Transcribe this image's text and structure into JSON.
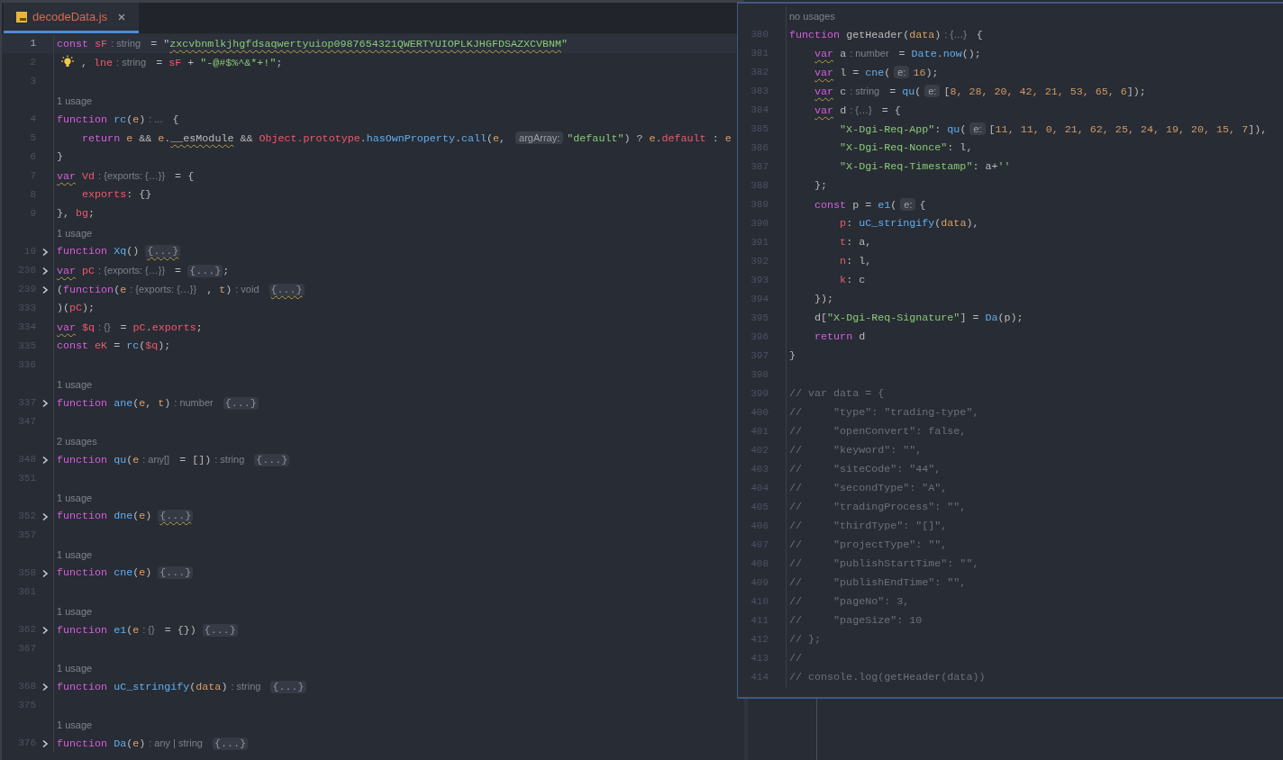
{
  "tab": {
    "label": "decodeData.js",
    "selected": true
  },
  "editor": {
    "lines": [
      {
        "kind": "code",
        "number": "1",
        "current": true,
        "tokens": [
          {
            "kind": "kw",
            "text": "const"
          },
          {
            "kind": "var",
            "text": " sF"
          },
          {
            "kind": "type-hint",
            "text": ": string"
          },
          {
            "kind": "pl",
            "text": " = \""
          },
          {
            "kind": "str",
            "text": "zxcvbnmlkjhgfdsaqwertyuiop0987654321QWERTYUIOPLKJHGFDSAZXCVBNM",
            "wavy": true
          },
          {
            "kind": "str",
            "text": "\""
          }
        ]
      },
      {
        "kind": "code",
        "number": "2",
        "bulb": true,
        "tokens": [
          {
            "kind": "pl",
            "text": " , "
          },
          {
            "kind": "var",
            "text": "lne"
          },
          {
            "kind": "type-hint",
            "text": ": string"
          },
          {
            "kind": "pl",
            "text": " = "
          },
          {
            "kind": "var",
            "text": "sF"
          },
          {
            "kind": "pl",
            "text": " + "
          },
          {
            "kind": "str",
            "text": "\"-@#$%^&*+!\""
          },
          {
            "kind": "pl",
            "text": ";"
          }
        ]
      },
      {
        "kind": "code",
        "number": "3"
      },
      {
        "kind": "usage",
        "text": "1 usage"
      },
      {
        "kind": "code",
        "number": "4",
        "tokens": [
          {
            "kind": "kw",
            "text": "function"
          },
          {
            "kind": "fn",
            "text": " rc"
          },
          {
            "kind": "pl",
            "text": "("
          },
          {
            "kind": "param",
            "text": "e"
          },
          {
            "kind": "pl",
            "text": ")"
          },
          {
            "kind": "type-hint",
            "text": ": ..."
          },
          {
            "kind": "pl",
            "text": " {"
          }
        ]
      },
      {
        "kind": "code",
        "number": "5",
        "tokens": [
          {
            "kind": "kw",
            "text": "    return"
          },
          {
            "kind": "param",
            "text": " e"
          },
          {
            "kind": "pl",
            "text": " && "
          },
          {
            "kind": "param",
            "text": "e"
          },
          {
            "kind": "pl",
            "text": "."
          },
          {
            "kind": "pl",
            "text": "__esModule",
            "wavy": true
          },
          {
            "kind": "pl",
            "text": " && "
          },
          {
            "kind": "var",
            "text": "Object.prototype"
          },
          {
            "kind": "pl",
            "text": "."
          },
          {
            "kind": "fn",
            "text": "hasOwnProperty"
          },
          {
            "kind": "pl",
            "text": "."
          },
          {
            "kind": "fn",
            "text": "call"
          },
          {
            "kind": "pl",
            "text": "("
          },
          {
            "kind": "param",
            "text": "e"
          },
          {
            "kind": "pl",
            "text": ", "
          },
          {
            "kind": "param-hint",
            "text": "argArray:"
          },
          {
            "kind": "str",
            "text": "\"default\""
          },
          {
            "kind": "pl",
            "text": ") ? "
          },
          {
            "kind": "param",
            "text": "e"
          },
          {
            "kind": "pl",
            "text": "."
          },
          {
            "kind": "var",
            "text": "default"
          },
          {
            "kind": "pl",
            "text": " : "
          },
          {
            "kind": "param",
            "text": "e"
          }
        ]
      },
      {
        "kind": "code",
        "number": "6",
        "tokens": [
          {
            "kind": "pl",
            "text": "}"
          }
        ]
      },
      {
        "kind": "code",
        "number": "7",
        "tokens": [
          {
            "kind": "kw",
            "text": "var",
            "wavy": true
          },
          {
            "kind": "var",
            "text": " Vd"
          },
          {
            "kind": "type-hint",
            "text": ": {exports: {…}}"
          },
          {
            "kind": "pl",
            "text": " = {"
          }
        ]
      },
      {
        "kind": "code",
        "number": "8",
        "tokens": [
          {
            "kind": "var",
            "text": "    exports"
          },
          {
            "kind": "pl",
            "text": ": {}"
          }
        ]
      },
      {
        "kind": "code",
        "number": "9",
        "tokens": [
          {
            "kind": "pl",
            "text": "}, "
          },
          {
            "kind": "var",
            "text": "bg"
          },
          {
            "kind": "pl",
            "text": ";"
          }
        ]
      },
      {
        "kind": "usage",
        "text": "1 usage"
      },
      {
        "kind": "code",
        "number": "10",
        "folded": true,
        "tokens": [
          {
            "kind": "kw",
            "text": "function"
          },
          {
            "kind": "fn",
            "text": " Xq"
          },
          {
            "kind": "pl",
            "text": "() "
          },
          {
            "kind": "fold",
            "text": "{...}",
            "wavy": true
          }
        ]
      },
      {
        "kind": "code",
        "number": "236",
        "folded": true,
        "tokens": [
          {
            "kind": "kw",
            "text": "var",
            "wavy": true
          },
          {
            "kind": "var",
            "text": " pC"
          },
          {
            "kind": "type-hint",
            "text": ": {exports: {…}}"
          },
          {
            "kind": "pl",
            "text": " = "
          },
          {
            "kind": "fold",
            "text": "{...}"
          },
          {
            "kind": "pl",
            "text": ";"
          }
        ]
      },
      {
        "kind": "code",
        "number": "239",
        "folded": true,
        "tokens": [
          {
            "kind": "pl",
            "text": "("
          },
          {
            "kind": "kw",
            "text": "function"
          },
          {
            "kind": "pl",
            "text": "("
          },
          {
            "kind": "param",
            "text": "e"
          },
          {
            "kind": "type-hint",
            "text": ": {exports: {…}}"
          },
          {
            "kind": "pl",
            "text": " , "
          },
          {
            "kind": "param",
            "text": "t"
          },
          {
            "kind": "pl",
            "text": ")"
          },
          {
            "kind": "type-hint",
            "text": ": void"
          },
          {
            "kind": "fold",
            "text": " {...}",
            "wavy": true
          }
        ]
      },
      {
        "kind": "code",
        "number": "333",
        "tokens": [
          {
            "kind": "pl",
            "text": ")("
          },
          {
            "kind": "var",
            "text": "pC"
          },
          {
            "kind": "pl",
            "text": ");"
          }
        ]
      },
      {
        "kind": "code",
        "number": "334",
        "tokens": [
          {
            "kind": "kw",
            "text": "var",
            "wavy": true
          },
          {
            "kind": "var",
            "text": " $q"
          },
          {
            "kind": "type-hint",
            "text": ": {}"
          },
          {
            "kind": "pl",
            "text": " = "
          },
          {
            "kind": "var",
            "text": "pC"
          },
          {
            "kind": "pl",
            "text": "."
          },
          {
            "kind": "var",
            "text": "exports"
          },
          {
            "kind": "pl",
            "text": ";"
          }
        ]
      },
      {
        "kind": "code",
        "number": "335",
        "tokens": [
          {
            "kind": "kw",
            "text": "const"
          },
          {
            "kind": "var",
            "text": " eK"
          },
          {
            "kind": "pl",
            "text": " = "
          },
          {
            "kind": "fn",
            "text": "rc"
          },
          {
            "kind": "pl",
            "text": "("
          },
          {
            "kind": "var",
            "text": "$q"
          },
          {
            "kind": "pl",
            "text": ");"
          }
        ]
      },
      {
        "kind": "code",
        "number": "336"
      },
      {
        "kind": "usage",
        "text": "1 usage"
      },
      {
        "kind": "code",
        "number": "337",
        "folded": true,
        "tokens": [
          {
            "kind": "kw",
            "text": "function"
          },
          {
            "kind": "fn",
            "text": " ane"
          },
          {
            "kind": "pl",
            "text": "("
          },
          {
            "kind": "param",
            "text": "e"
          },
          {
            "kind": "pl",
            "text": ", "
          },
          {
            "kind": "param",
            "text": "t"
          },
          {
            "kind": "pl",
            "text": ")"
          },
          {
            "kind": "type-hint",
            "text": ": number"
          },
          {
            "kind": "fold",
            "text": " {...}"
          }
        ]
      },
      {
        "kind": "code",
        "number": "347"
      },
      {
        "kind": "usage",
        "text": "2 usages"
      },
      {
        "kind": "code",
        "number": "348",
        "folded": true,
        "tokens": [
          {
            "kind": "kw",
            "text": "function"
          },
          {
            "kind": "fn",
            "text": " qu"
          },
          {
            "kind": "pl",
            "text": "("
          },
          {
            "kind": "param",
            "text": "e"
          },
          {
            "kind": "type-hint",
            "text": ": any[]"
          },
          {
            "kind": "pl",
            "text": " = [])"
          },
          {
            "kind": "type-hint",
            "text": ": string"
          },
          {
            "kind": "fold",
            "text": " {...}"
          }
        ]
      },
      {
        "kind": "code",
        "number": "351"
      },
      {
        "kind": "usage",
        "text": "1 usage"
      },
      {
        "kind": "code",
        "number": "352",
        "folded": true,
        "tokens": [
          {
            "kind": "kw",
            "text": "function"
          },
          {
            "kind": "fn",
            "text": " dne"
          },
          {
            "kind": "pl",
            "text": "("
          },
          {
            "kind": "param",
            "text": "e"
          },
          {
            "kind": "pl",
            "text": ") "
          },
          {
            "kind": "fold",
            "text": "{...}",
            "wavy": true
          }
        ]
      },
      {
        "kind": "code",
        "number": "357"
      },
      {
        "kind": "usage",
        "text": "1 usage"
      },
      {
        "kind": "code",
        "number": "358",
        "folded": true,
        "tokens": [
          {
            "kind": "kw",
            "text": "function"
          },
          {
            "kind": "fn",
            "text": " cne"
          },
          {
            "kind": "pl",
            "text": "("
          },
          {
            "kind": "param",
            "text": "e"
          },
          {
            "kind": "pl",
            "text": ") "
          },
          {
            "kind": "fold",
            "text": "{...}"
          }
        ]
      },
      {
        "kind": "code",
        "number": "361"
      },
      {
        "kind": "usage",
        "text": "1 usage"
      },
      {
        "kind": "code",
        "number": "362",
        "folded": true,
        "tokens": [
          {
            "kind": "kw",
            "text": "function"
          },
          {
            "kind": "fn",
            "text": " e1"
          },
          {
            "kind": "pl",
            "text": "("
          },
          {
            "kind": "param",
            "text": "e"
          },
          {
            "kind": "type-hint",
            "text": ": {}"
          },
          {
            "kind": "pl",
            "text": " = {}) "
          },
          {
            "kind": "fold",
            "text": "{...}"
          }
        ]
      },
      {
        "kind": "code",
        "number": "367"
      },
      {
        "kind": "usage",
        "text": "1 usage"
      },
      {
        "kind": "code",
        "number": "368",
        "folded": true,
        "tokens": [
          {
            "kind": "kw",
            "text": "function"
          },
          {
            "kind": "fn",
            "text": " uC_stringify"
          },
          {
            "kind": "pl",
            "text": "("
          },
          {
            "kind": "param",
            "text": "data"
          },
          {
            "kind": "pl",
            "text": ")"
          },
          {
            "kind": "type-hint",
            "text": ": string"
          },
          {
            "kind": "fold",
            "text": " {...}"
          }
        ]
      },
      {
        "kind": "code",
        "number": "375"
      },
      {
        "kind": "usage",
        "text": "1 usage"
      },
      {
        "kind": "code",
        "number": "376",
        "folded": true,
        "tokens": [
          {
            "kind": "kw",
            "text": "function"
          },
          {
            "kind": "fn",
            "text": " Da"
          },
          {
            "kind": "pl",
            "text": "("
          },
          {
            "kind": "param",
            "text": "e"
          },
          {
            "kind": "pl",
            "text": ")"
          },
          {
            "kind": "type-hint",
            "text": ": any | string"
          },
          {
            "kind": "fold",
            "text": " {...}"
          }
        ]
      }
    ]
  },
  "popup": {
    "lines": [
      {
        "kind": "usage",
        "text": "no usages"
      },
      {
        "kind": "code",
        "number": "380",
        "tokens": [
          {
            "kind": "kw",
            "text": "function"
          },
          {
            "kind": "pl",
            "text": " getHeader("
          },
          {
            "kind": "param",
            "text": "data"
          },
          {
            "kind": "pl",
            "text": ")"
          },
          {
            "kind": "type-hint",
            "text": ": {…}"
          },
          {
            "kind": "pl",
            "text": " {"
          }
        ]
      },
      {
        "kind": "code",
        "number": "381",
        "tokens": [
          {
            "kind": "kw",
            "text": "    var",
            "wavy": true
          },
          {
            "kind": "pl",
            "text": " a"
          },
          {
            "kind": "type-hint",
            "text": ": number"
          },
          {
            "kind": "pl",
            "text": " = "
          },
          {
            "kind": "fn",
            "text": "Date"
          },
          {
            "kind": "pl",
            "text": "."
          },
          {
            "kind": "fn",
            "text": "now"
          },
          {
            "kind": "pl",
            "text": "();"
          }
        ]
      },
      {
        "kind": "code",
        "number": "382",
        "tokens": [
          {
            "kind": "kw",
            "text": "    var",
            "wavy": true
          },
          {
            "kind": "pl",
            "text": " l = "
          },
          {
            "kind": "fn",
            "text": "cne"
          },
          {
            "kind": "pl",
            "text": "("
          },
          {
            "kind": "param-hint",
            "text": "e:"
          },
          {
            "kind": "num",
            "text": "16"
          },
          {
            "kind": "pl",
            "text": ");"
          }
        ]
      },
      {
        "kind": "code",
        "number": "383",
        "tokens": [
          {
            "kind": "kw",
            "text": "    var",
            "wavy": true
          },
          {
            "kind": "pl",
            "text": " c"
          },
          {
            "kind": "type-hint",
            "text": ": string"
          },
          {
            "kind": "pl",
            "text": " = "
          },
          {
            "kind": "fn",
            "text": "qu"
          },
          {
            "kind": "pl",
            "text": "("
          },
          {
            "kind": "param-hint",
            "text": "e:"
          },
          {
            "kind": "pl",
            "text": "["
          },
          {
            "kind": "num",
            "text": "8, 28, 20, 42, 21, 53, 65, 6"
          },
          {
            "kind": "pl",
            "text": "]);"
          }
        ]
      },
      {
        "kind": "code",
        "number": "384",
        "tokens": [
          {
            "kind": "kw",
            "text": "    var",
            "wavy": true
          },
          {
            "kind": "pl",
            "text": " d"
          },
          {
            "kind": "type-hint",
            "text": ": {…}"
          },
          {
            "kind": "pl",
            "text": " = {"
          }
        ]
      },
      {
        "kind": "code",
        "number": "385",
        "tokens": [
          {
            "kind": "str",
            "text": "        \"X-Dgi-Req-App\""
          },
          {
            "kind": "pl",
            "text": ": "
          },
          {
            "kind": "fn",
            "text": "qu"
          },
          {
            "kind": "pl",
            "text": "("
          },
          {
            "kind": "param-hint",
            "text": "e:"
          },
          {
            "kind": "pl",
            "text": "["
          },
          {
            "kind": "num",
            "text": "11, 11, 0, 21, 62, 25, 24, 19, 20, 15, 7"
          },
          {
            "kind": "pl",
            "text": "]),"
          }
        ]
      },
      {
        "kind": "code",
        "number": "386",
        "tokens": [
          {
            "kind": "str",
            "text": "        \"X-Dgi-Req-Nonce\""
          },
          {
            "kind": "pl",
            "text": ": l,"
          }
        ]
      },
      {
        "kind": "code",
        "number": "387",
        "tokens": [
          {
            "kind": "str",
            "text": "        \"X-Dgi-Req-Timestamp\""
          },
          {
            "kind": "pl",
            "text": ": a+"
          },
          {
            "kind": "str",
            "text": "''"
          }
        ]
      },
      {
        "kind": "code",
        "number": "388",
        "tokens": [
          {
            "kind": "pl",
            "text": "    };"
          }
        ]
      },
      {
        "kind": "code",
        "number": "389",
        "tokens": [
          {
            "kind": "kw",
            "text": "    const"
          },
          {
            "kind": "pl",
            "text": " p = "
          },
          {
            "kind": "fn",
            "text": "e1"
          },
          {
            "kind": "pl",
            "text": "("
          },
          {
            "kind": "param-hint",
            "text": "e:"
          },
          {
            "kind": "pl",
            "text": "{"
          }
        ]
      },
      {
        "kind": "code",
        "number": "390",
        "tokens": [
          {
            "kind": "var",
            "text": "        p"
          },
          {
            "kind": "pl",
            "text": ": "
          },
          {
            "kind": "fn",
            "text": "uC_stringify"
          },
          {
            "kind": "pl",
            "text": "("
          },
          {
            "kind": "param",
            "text": "data"
          },
          {
            "kind": "pl",
            "text": "),"
          }
        ]
      },
      {
        "kind": "code",
        "number": "391",
        "tokens": [
          {
            "kind": "var",
            "text": "        t"
          },
          {
            "kind": "pl",
            "text": ": a,"
          }
        ]
      },
      {
        "kind": "code",
        "number": "392",
        "tokens": [
          {
            "kind": "var",
            "text": "        n"
          },
          {
            "kind": "pl",
            "text": ": l,"
          }
        ]
      },
      {
        "kind": "code",
        "number": "393",
        "tokens": [
          {
            "kind": "var",
            "text": "        k"
          },
          {
            "kind": "pl",
            "text": ": c"
          }
        ]
      },
      {
        "kind": "code",
        "number": "394",
        "tokens": [
          {
            "kind": "pl",
            "text": "    });"
          }
        ]
      },
      {
        "kind": "code",
        "number": "395",
        "tokens": [
          {
            "kind": "pl",
            "text": "    d["
          },
          {
            "kind": "str",
            "text": "\"X-Dgi-Req-Signature\""
          },
          {
            "kind": "pl",
            "text": "] = "
          },
          {
            "kind": "fn",
            "text": "Da"
          },
          {
            "kind": "pl",
            "text": "(p);"
          }
        ]
      },
      {
        "kind": "code",
        "number": "396",
        "tokens": [
          {
            "kind": "kw",
            "text": "    return"
          },
          {
            "kind": "pl",
            "text": " d"
          }
        ]
      },
      {
        "kind": "code",
        "number": "397",
        "tokens": [
          {
            "kind": "pl",
            "text": "}"
          }
        ]
      },
      {
        "kind": "code",
        "number": "398"
      },
      {
        "kind": "code",
        "number": "399",
        "tokens": [
          {
            "kind": "cmt",
            "text": "// var data = {"
          }
        ]
      },
      {
        "kind": "code",
        "number": "400",
        "tokens": [
          {
            "kind": "cmt",
            "text": "//     \"type\": \"trading-type\","
          }
        ]
      },
      {
        "kind": "code",
        "number": "401",
        "tokens": [
          {
            "kind": "cmt",
            "text": "//     \"openConvert\": false,"
          }
        ]
      },
      {
        "kind": "code",
        "number": "402",
        "tokens": [
          {
            "kind": "cmt",
            "text": "//     \"keyword\": \"\","
          }
        ]
      },
      {
        "kind": "code",
        "number": "403",
        "tokens": [
          {
            "kind": "cmt",
            "text": "//     \"siteCode\": \"44\","
          }
        ]
      },
      {
        "kind": "code",
        "number": "404",
        "tokens": [
          {
            "kind": "cmt",
            "text": "//     \"secondType\": \"A\","
          }
        ]
      },
      {
        "kind": "code",
        "number": "405",
        "tokens": [
          {
            "kind": "cmt",
            "text": "//     \"tradingProcess\": \"\","
          }
        ]
      },
      {
        "kind": "code",
        "number": "406",
        "tokens": [
          {
            "kind": "cmt",
            "text": "//     \"thirdType\": \"[]\","
          }
        ]
      },
      {
        "kind": "code",
        "number": "407",
        "tokens": [
          {
            "kind": "cmt",
            "text": "//     \"projectType\": \"\","
          }
        ]
      },
      {
        "kind": "code",
        "number": "408",
        "tokens": [
          {
            "kind": "cmt",
            "text": "//     \"publishStartTime\": \"\","
          }
        ]
      },
      {
        "kind": "code",
        "number": "409",
        "tokens": [
          {
            "kind": "cmt",
            "text": "//     \"publishEndTime\": \"\","
          }
        ]
      },
      {
        "kind": "code",
        "number": "410",
        "tokens": [
          {
            "kind": "cmt",
            "text": "//     \"pageNo\": 3,"
          }
        ]
      },
      {
        "kind": "code",
        "number": "411",
        "tokens": [
          {
            "kind": "cmt",
            "text": "//     \"pageSize\": 10"
          }
        ]
      },
      {
        "kind": "code",
        "number": "412",
        "tokens": [
          {
            "kind": "cmt",
            "text": "// };"
          }
        ]
      },
      {
        "kind": "code",
        "number": "413",
        "tokens": [
          {
            "kind": "cmt",
            "text": "//"
          }
        ]
      },
      {
        "kind": "code",
        "number": "414",
        "tokens": [
          {
            "kind": "cmt",
            "text": "// console.log(getHeader(data))"
          }
        ]
      }
    ]
  }
}
